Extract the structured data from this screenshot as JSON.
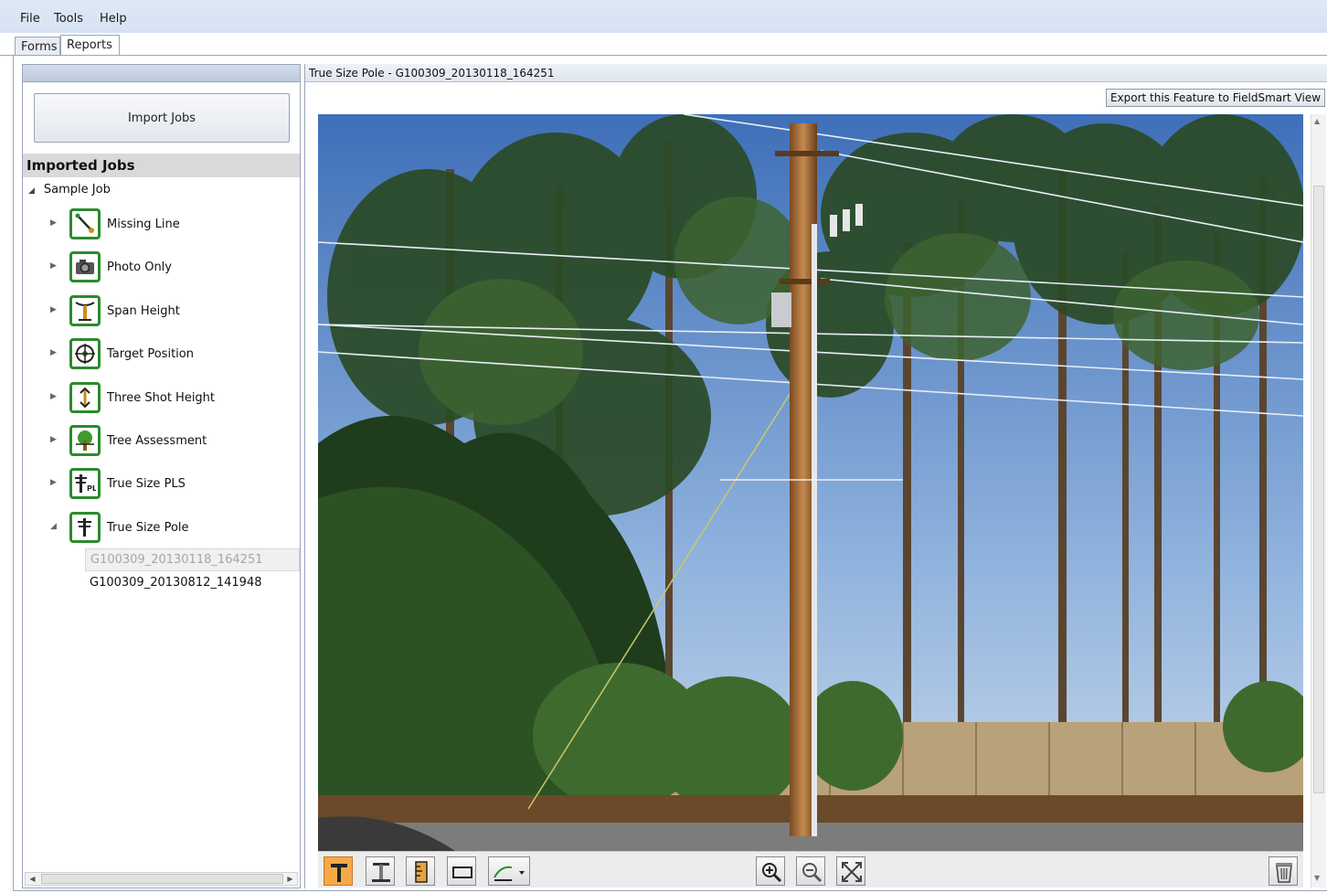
{
  "menu": {
    "items": [
      "File",
      "Tools",
      "Help"
    ]
  },
  "tabs": [
    {
      "label": "Forms",
      "active": false
    },
    {
      "label": "Reports",
      "active": true
    }
  ],
  "left_panel": {
    "import_button": "Import Jobs",
    "imported_jobs_title": "Imported Jobs",
    "job": {
      "name": "Sample Job",
      "expanded": true
    },
    "categories": [
      {
        "label": "Missing Line",
        "icon": "missing-line-icon",
        "expanded": false
      },
      {
        "label": "Photo Only",
        "icon": "camera-icon",
        "expanded": false
      },
      {
        "label": "Span Height",
        "icon": "span-height-icon",
        "expanded": false
      },
      {
        "label": "Target Position",
        "icon": "crosshair-target-icon",
        "expanded": false
      },
      {
        "label": "Three Shot Height",
        "icon": "height-arrow-icon",
        "expanded": false
      },
      {
        "label": "Tree Assessment",
        "icon": "tree-icon",
        "expanded": false
      },
      {
        "label": "True Size PLS",
        "icon": "pole-pls-icon",
        "expanded": false
      },
      {
        "label": "True Size Pole",
        "icon": "pole-icon",
        "expanded": true
      }
    ],
    "records": [
      {
        "label": "G100309_20130118_164251",
        "selected": true
      },
      {
        "label": "G100309_20130812_141948",
        "selected": false
      }
    ]
  },
  "viewer": {
    "title": "True Size Pole - G100309_20130118_164251",
    "export_button": "Export this Feature to FieldSmart View",
    "photo_description_icon": "utility-pole-photo",
    "toolbar": {
      "tools": [
        {
          "name": "pole-top-tool",
          "active": true
        },
        {
          "name": "pole-measure-tool",
          "active": false
        },
        {
          "name": "ruler-tool",
          "active": false
        },
        {
          "name": "rectangle-tool",
          "active": false
        },
        {
          "name": "line-tool-dropdown",
          "active": false
        }
      ],
      "zoom": [
        "zoom-in",
        "zoom-out",
        "fit-to-window"
      ],
      "delete": "delete"
    }
  },
  "colors": {
    "accent_active": "#f7a948",
    "icon_green": "#2c8a2c",
    "menubar": "#d6e2f3"
  }
}
